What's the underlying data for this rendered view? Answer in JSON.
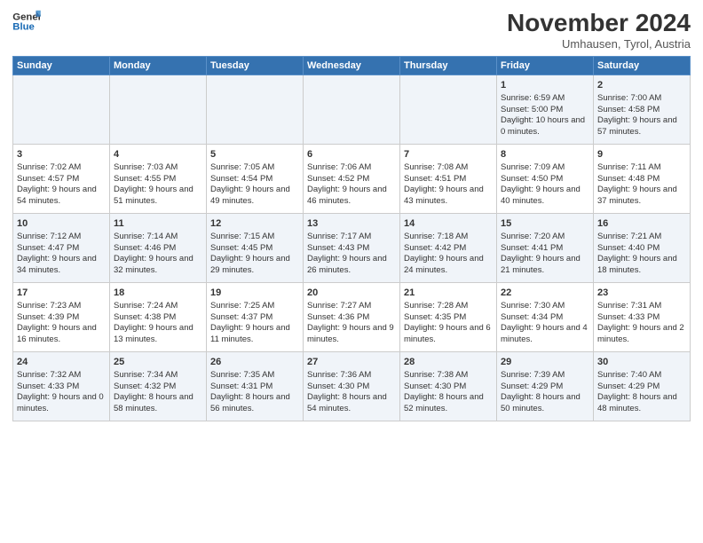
{
  "header": {
    "logo_line1": "General",
    "logo_line2": "Blue",
    "month": "November 2024",
    "location": "Umhausen, Tyrol, Austria"
  },
  "columns": [
    "Sunday",
    "Monday",
    "Tuesday",
    "Wednesday",
    "Thursday",
    "Friday",
    "Saturday"
  ],
  "weeks": [
    [
      {
        "day": "",
        "info": ""
      },
      {
        "day": "",
        "info": ""
      },
      {
        "day": "",
        "info": ""
      },
      {
        "day": "",
        "info": ""
      },
      {
        "day": "",
        "info": ""
      },
      {
        "day": "1",
        "info": "Sunrise: 6:59 AM\nSunset: 5:00 PM\nDaylight: 10 hours and 0 minutes."
      },
      {
        "day": "2",
        "info": "Sunrise: 7:00 AM\nSunset: 4:58 PM\nDaylight: 9 hours and 57 minutes."
      }
    ],
    [
      {
        "day": "3",
        "info": "Sunrise: 7:02 AM\nSunset: 4:57 PM\nDaylight: 9 hours and 54 minutes."
      },
      {
        "day": "4",
        "info": "Sunrise: 7:03 AM\nSunset: 4:55 PM\nDaylight: 9 hours and 51 minutes."
      },
      {
        "day": "5",
        "info": "Sunrise: 7:05 AM\nSunset: 4:54 PM\nDaylight: 9 hours and 49 minutes."
      },
      {
        "day": "6",
        "info": "Sunrise: 7:06 AM\nSunset: 4:52 PM\nDaylight: 9 hours and 46 minutes."
      },
      {
        "day": "7",
        "info": "Sunrise: 7:08 AM\nSunset: 4:51 PM\nDaylight: 9 hours and 43 minutes."
      },
      {
        "day": "8",
        "info": "Sunrise: 7:09 AM\nSunset: 4:50 PM\nDaylight: 9 hours and 40 minutes."
      },
      {
        "day": "9",
        "info": "Sunrise: 7:11 AM\nSunset: 4:48 PM\nDaylight: 9 hours and 37 minutes."
      }
    ],
    [
      {
        "day": "10",
        "info": "Sunrise: 7:12 AM\nSunset: 4:47 PM\nDaylight: 9 hours and 34 minutes."
      },
      {
        "day": "11",
        "info": "Sunrise: 7:14 AM\nSunset: 4:46 PM\nDaylight: 9 hours and 32 minutes."
      },
      {
        "day": "12",
        "info": "Sunrise: 7:15 AM\nSunset: 4:45 PM\nDaylight: 9 hours and 29 minutes."
      },
      {
        "day": "13",
        "info": "Sunrise: 7:17 AM\nSunset: 4:43 PM\nDaylight: 9 hours and 26 minutes."
      },
      {
        "day": "14",
        "info": "Sunrise: 7:18 AM\nSunset: 4:42 PM\nDaylight: 9 hours and 24 minutes."
      },
      {
        "day": "15",
        "info": "Sunrise: 7:20 AM\nSunset: 4:41 PM\nDaylight: 9 hours and 21 minutes."
      },
      {
        "day": "16",
        "info": "Sunrise: 7:21 AM\nSunset: 4:40 PM\nDaylight: 9 hours and 18 minutes."
      }
    ],
    [
      {
        "day": "17",
        "info": "Sunrise: 7:23 AM\nSunset: 4:39 PM\nDaylight: 9 hours and 16 minutes."
      },
      {
        "day": "18",
        "info": "Sunrise: 7:24 AM\nSunset: 4:38 PM\nDaylight: 9 hours and 13 minutes."
      },
      {
        "day": "19",
        "info": "Sunrise: 7:25 AM\nSunset: 4:37 PM\nDaylight: 9 hours and 11 minutes."
      },
      {
        "day": "20",
        "info": "Sunrise: 7:27 AM\nSunset: 4:36 PM\nDaylight: 9 hours and 9 minutes."
      },
      {
        "day": "21",
        "info": "Sunrise: 7:28 AM\nSunset: 4:35 PM\nDaylight: 9 hours and 6 minutes."
      },
      {
        "day": "22",
        "info": "Sunrise: 7:30 AM\nSunset: 4:34 PM\nDaylight: 9 hours and 4 minutes."
      },
      {
        "day": "23",
        "info": "Sunrise: 7:31 AM\nSunset: 4:33 PM\nDaylight: 9 hours and 2 minutes."
      }
    ],
    [
      {
        "day": "24",
        "info": "Sunrise: 7:32 AM\nSunset: 4:33 PM\nDaylight: 9 hours and 0 minutes."
      },
      {
        "day": "25",
        "info": "Sunrise: 7:34 AM\nSunset: 4:32 PM\nDaylight: 8 hours and 58 minutes."
      },
      {
        "day": "26",
        "info": "Sunrise: 7:35 AM\nSunset: 4:31 PM\nDaylight: 8 hours and 56 minutes."
      },
      {
        "day": "27",
        "info": "Sunrise: 7:36 AM\nSunset: 4:30 PM\nDaylight: 8 hours and 54 minutes."
      },
      {
        "day": "28",
        "info": "Sunrise: 7:38 AM\nSunset: 4:30 PM\nDaylight: 8 hours and 52 minutes."
      },
      {
        "day": "29",
        "info": "Sunrise: 7:39 AM\nSunset: 4:29 PM\nDaylight: 8 hours and 50 minutes."
      },
      {
        "day": "30",
        "info": "Sunrise: 7:40 AM\nSunset: 4:29 PM\nDaylight: 8 hours and 48 minutes."
      }
    ]
  ]
}
